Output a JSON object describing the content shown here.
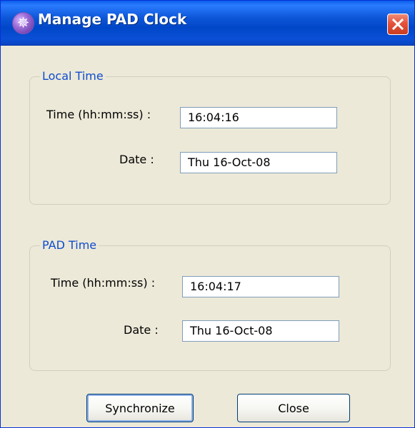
{
  "window": {
    "title": "Manage PAD Clock",
    "icon_glyph": "✵",
    "title_icon": "app-icon",
    "close_icon": "close-icon"
  },
  "local_time": {
    "legend": "Local Time",
    "time_label": "Time (hh:mm:ss) :",
    "time_value": "16:04:16",
    "date_label": "Date :",
    "date_value": "Thu 16-Oct-08"
  },
  "pad_time": {
    "legend": "PAD Time",
    "time_label": "Time (hh:mm:ss) :",
    "time_value": "16:04:17",
    "date_label": "Date :",
    "date_value": "Thu 16-Oct-08"
  },
  "buttons": {
    "synchronize": "Synchronize",
    "close": "Close"
  },
  "colors": {
    "titlebar": "#0047c8",
    "window_bg": "#ece9d8",
    "legend_text": "#0f4ccf",
    "close_button": "#e5523b"
  }
}
